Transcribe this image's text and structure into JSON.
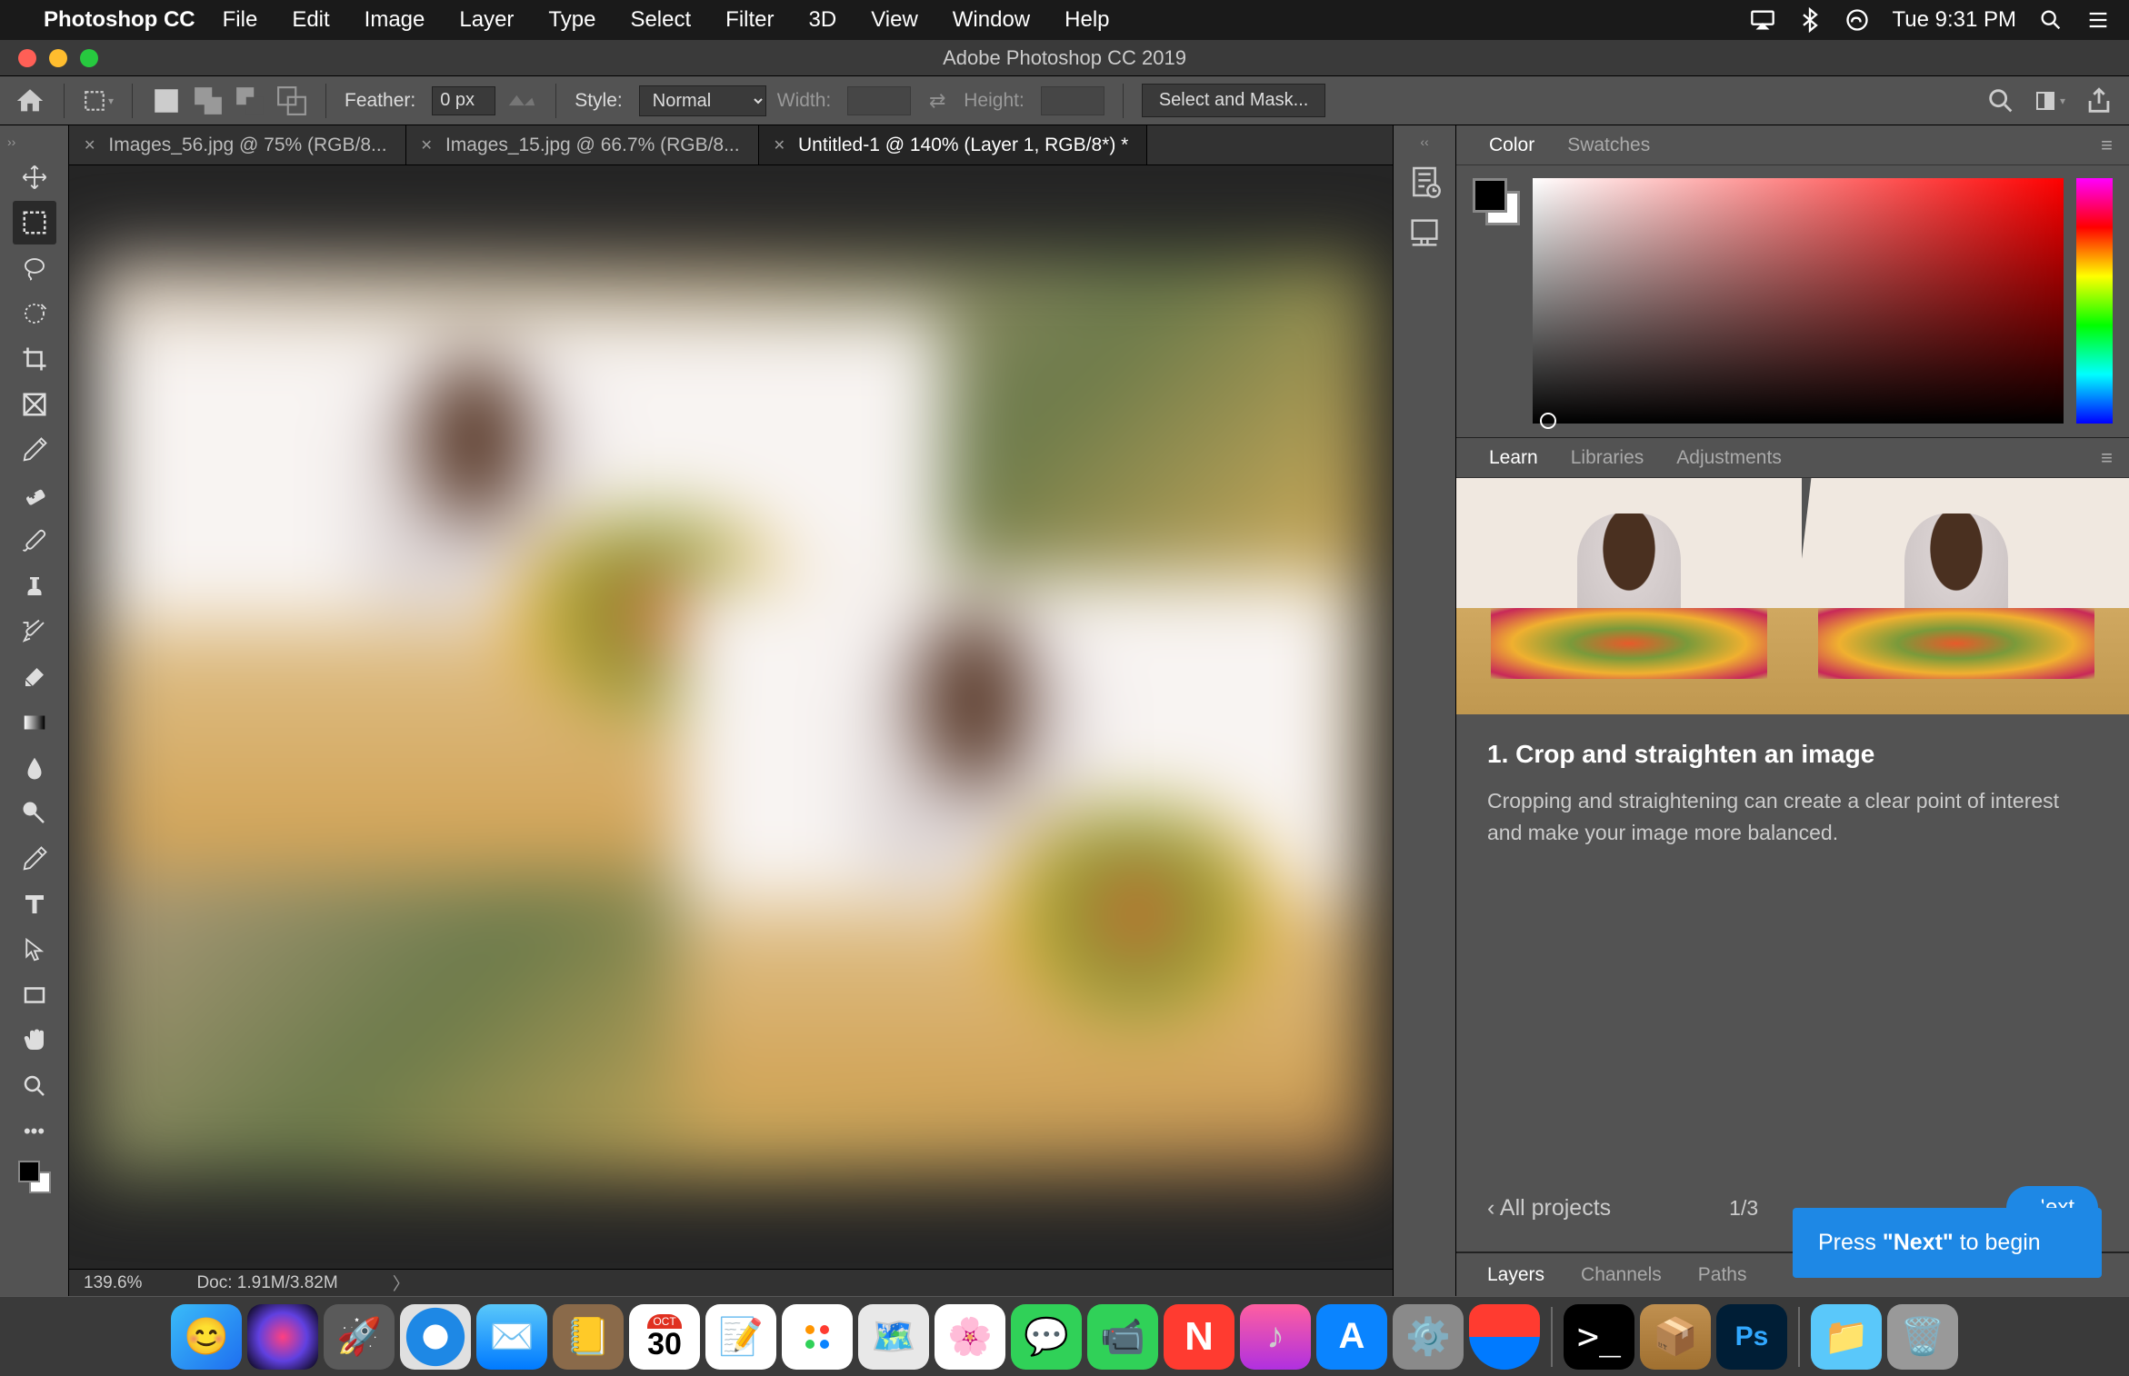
{
  "menubar": {
    "app_name": "Photoshop CC",
    "items": [
      "File",
      "Edit",
      "Image",
      "Layer",
      "Type",
      "Select",
      "Filter",
      "3D",
      "View",
      "Window",
      "Help"
    ],
    "clock": "Tue 9:31 PM"
  },
  "window_title": "Adobe Photoshop CC 2019",
  "options": {
    "feather_label": "Feather:",
    "feather_value": "0 px",
    "style_label": "Style:",
    "style_value": "Normal",
    "width_label": "Width:",
    "height_label": "Height:",
    "select_mask_label": "Select and Mask..."
  },
  "doc_tabs": [
    {
      "label": "Images_56.jpg @ 75% (RGB/8...",
      "active": false
    },
    {
      "label": "Images_15.jpg @ 66.7% (RGB/8...",
      "active": false
    },
    {
      "label": "Untitled-1 @ 140% (Layer 1, RGB/8*) *",
      "active": true
    }
  ],
  "status": {
    "zoom": "139.6%",
    "doc": "Doc: 1.91M/3.82M"
  },
  "panels": {
    "color_tabs": [
      "Color",
      "Swatches"
    ],
    "learn_tabs": [
      "Learn",
      "Libraries",
      "Adjustments"
    ],
    "bottom_tabs": [
      "Layers",
      "Channels",
      "Paths"
    ]
  },
  "learn": {
    "title": "1.  Crop and straighten an image",
    "body": "Cropping and straightening can create a clear point of interest and make your image more balanced.",
    "back_label": "‹  All projects",
    "counter": "1/3",
    "next_label": "Next"
  },
  "tooltip": {
    "press": "Press ",
    "quote_next": "\"Next\"",
    "to_begin": " to begin"
  },
  "dock_calendar_day": "30",
  "dock_calendar_month": "OCT"
}
